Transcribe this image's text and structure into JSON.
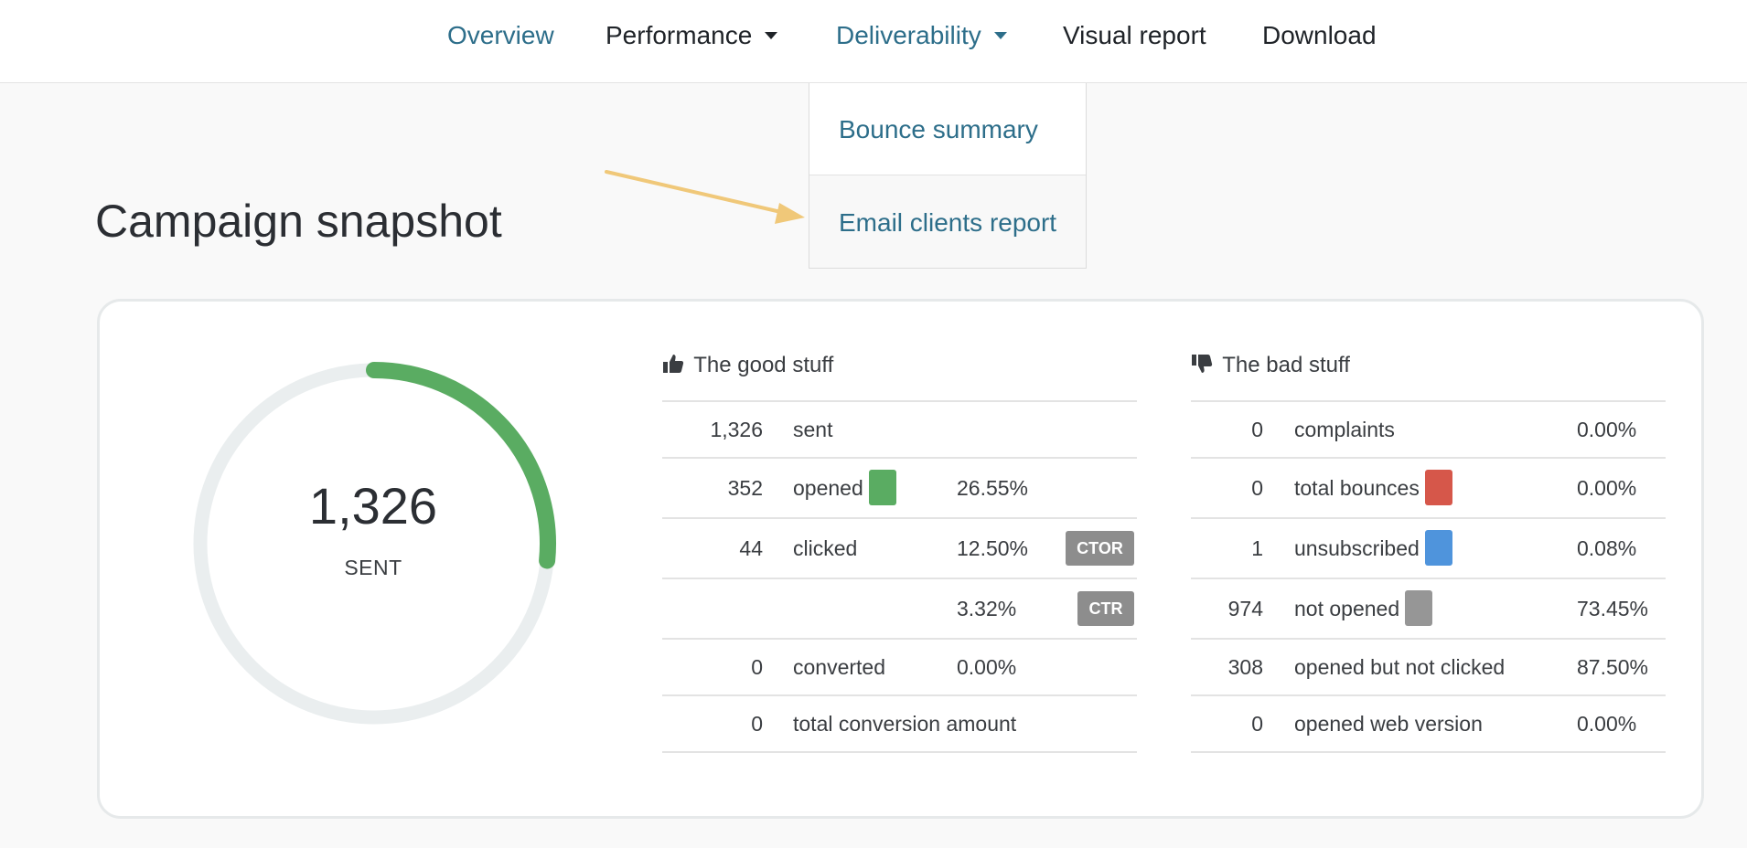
{
  "nav": {
    "items": [
      {
        "label": "Overview",
        "has_caret": false
      },
      {
        "label": "Performance",
        "has_caret": true
      },
      {
        "label": "Deliverability",
        "has_caret": true
      },
      {
        "label": "Visual report",
        "has_caret": false
      },
      {
        "label": "Download",
        "has_caret": false
      }
    ],
    "dropdown": [
      "Bounce summary",
      "Email clients report"
    ]
  },
  "page_title": "Campaign snapshot",
  "donut": {
    "count": "1,326",
    "label": "SENT",
    "progress": 0.2655,
    "fill_color": "#5aac62",
    "track_color": "#eaeeef"
  },
  "good": {
    "heading": "The good stuff",
    "icon": "thumbs-up-icon",
    "rows": [
      {
        "count": "1,326",
        "label": "sent",
        "percent": "",
        "badge": ""
      },
      {
        "count": "352",
        "label": "opened",
        "percent": "26.55%",
        "badge": ""
      },
      {
        "count": "44",
        "label": "clicked",
        "percent": "12.50%",
        "badge": "CTOR"
      },
      {
        "count": "",
        "label": "",
        "percent": "3.32%",
        "badge": "CTR"
      },
      {
        "count": "0",
        "label": "converted",
        "percent": "0.00%",
        "badge": ""
      },
      {
        "count": "0",
        "label": "total conversion amount",
        "percent": "",
        "badge": ""
      }
    ]
  },
  "bad": {
    "heading": "The bad stuff",
    "icon": "thumbs-down-icon",
    "rows": [
      {
        "count": "0",
        "label": "complaints",
        "percent": "0.00%"
      },
      {
        "count": "0",
        "label": "total bounces",
        "percent": "0.00%"
      },
      {
        "count": "1",
        "label": "unsubscribed",
        "percent": "0.08%"
      },
      {
        "count": "974",
        "label": "not opened",
        "percent": "73.45%"
      },
      {
        "count": "308",
        "label": "opened but not clicked",
        "percent": "87.50%"
      },
      {
        "count": "0",
        "label": "opened web version",
        "percent": "0.00%"
      }
    ]
  },
  "colors": {
    "opened": "#5aac62",
    "bounces": "#d6574a",
    "unsubscribed": "#4f94dc",
    "not_opened": "#969696",
    "link": "#2d6e8a",
    "arrow": "#f0c879"
  }
}
